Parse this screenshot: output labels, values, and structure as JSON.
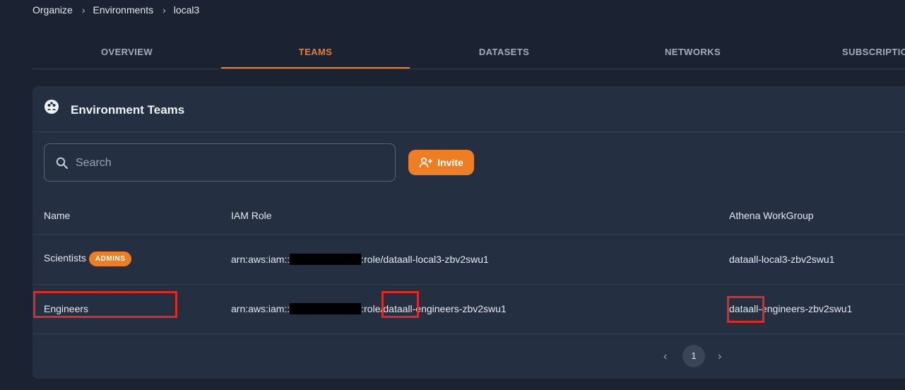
{
  "breadcrumb": [
    "Organize",
    "Environments",
    "local3"
  ],
  "tabs": [
    {
      "label": "OVERVIEW",
      "active": false
    },
    {
      "label": "TEAMS",
      "active": true
    },
    {
      "label": "DATASETS",
      "active": false
    },
    {
      "label": "NETWORKS",
      "active": false
    },
    {
      "label": "SUBSCRIPTIO",
      "active": false
    }
  ],
  "card": {
    "title": "Environment Teams"
  },
  "search": {
    "placeholder": "Search",
    "value": ""
  },
  "invite_label": "Invite",
  "table": {
    "headers": [
      "Name",
      "IAM Role",
      "Athena WorkGroup"
    ],
    "rows": [
      {
        "name": "Scientists",
        "badge": "ADMINS",
        "iam_prefix": "arn:aws:iam::",
        "iam_suffix": ":role/dataall-local3-zbv2swu1",
        "workgroup": "dataall-local3-zbv2swu1"
      },
      {
        "name": "Engineers",
        "badge": "",
        "iam_prefix": "arn:aws:iam::",
        "iam_suffix": ":role/dataall-engineers-zbv2swu1",
        "workgroup": "dataall-engineers-zbv2swu1"
      }
    ]
  },
  "pagination": {
    "current_page": "1"
  },
  "colors": {
    "accent": "#ef7d22",
    "background": "#1b2332",
    "card": "#243042",
    "highlight": "#e02a1f"
  },
  "icons": {
    "header": "team-icon",
    "search": "search-icon",
    "invite": "add-user-icon",
    "prev": "chevron-left-icon",
    "next": "chevron-right-icon",
    "separator": "chevron-right-icon"
  }
}
